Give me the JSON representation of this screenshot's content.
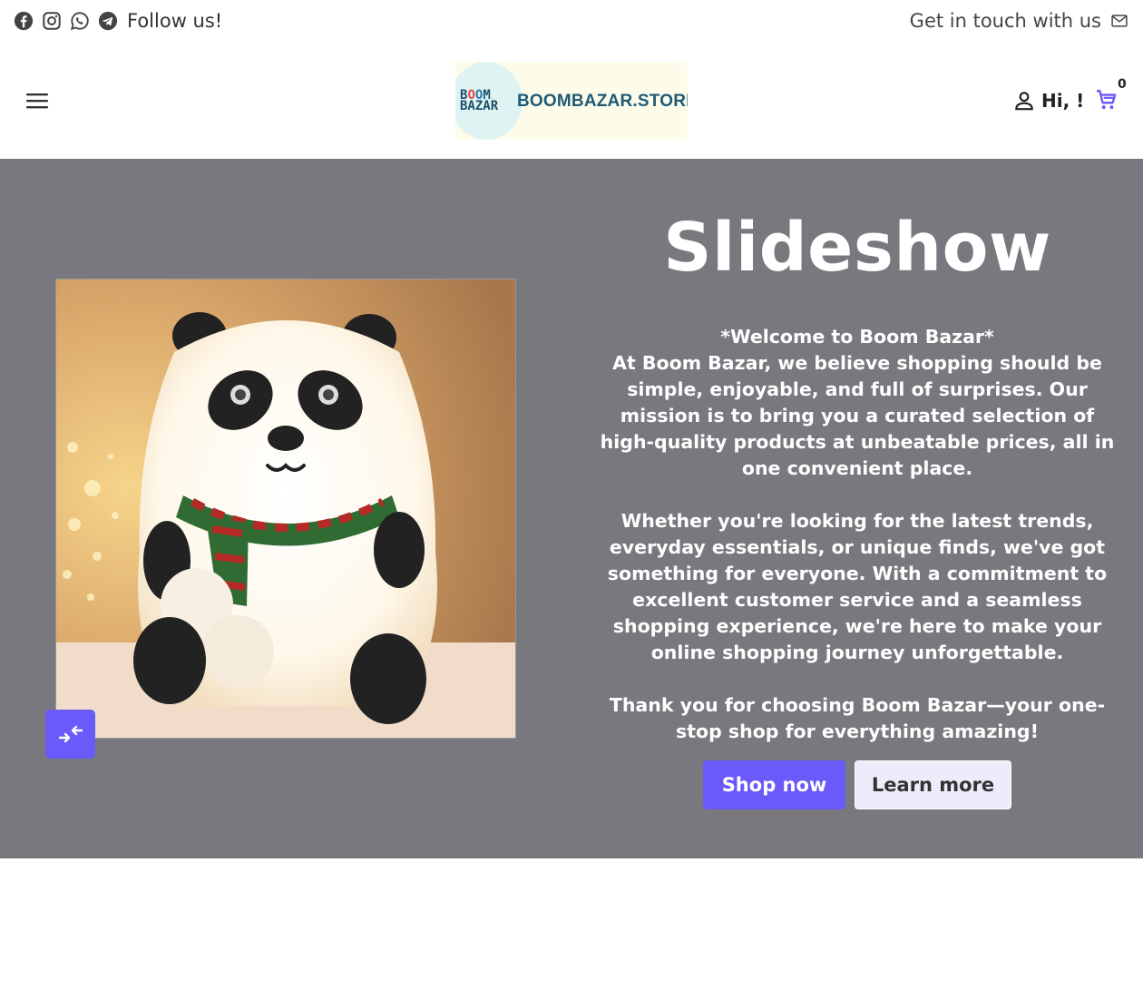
{
  "topbar": {
    "follow_label": "Follow us!",
    "social_icons": [
      "facebook-icon",
      "instagram-icon",
      "whatsapp-icon",
      "telegram-icon"
    ],
    "contact_label": "Get in touch with us",
    "contact_icon": "mail-icon"
  },
  "header": {
    "logo_mark_line1_a": "B",
    "logo_mark_line1_b": "O",
    "logo_mark_line1_c": "O",
    "logo_mark_line1_d": "M",
    "logo_mark_line2": "BAZAR",
    "logo_text": "BOOMBAZAR.STORE",
    "greeting": "Hi, !",
    "cart_count": "0"
  },
  "hero": {
    "title": "Slideshow",
    "body": "*Welcome to Boom Bazar*\nAt Boom Bazar, we believe shopping should be simple, enjoyable, and full of surprises. Our mission is to bring you a curated selection of high-quality products at unbeatable prices, all in one convenient place.\n\nWhether you're looking for the latest trends, everyday essentials, or unique finds, we've got something for everyone. With a commitment to excellent customer service and a seamless shopping experience, we're here to make your online shopping journey unforgettable.\n\nThank you for choosing Boom Bazar—your one-stop shop for everything amazing!",
    "primary_button": "Shop now",
    "secondary_button": "Learn more"
  },
  "colors": {
    "hero_background": "#78787e",
    "accent": "#6a5af9",
    "secondary_button_bg": "#eeecfb"
  }
}
